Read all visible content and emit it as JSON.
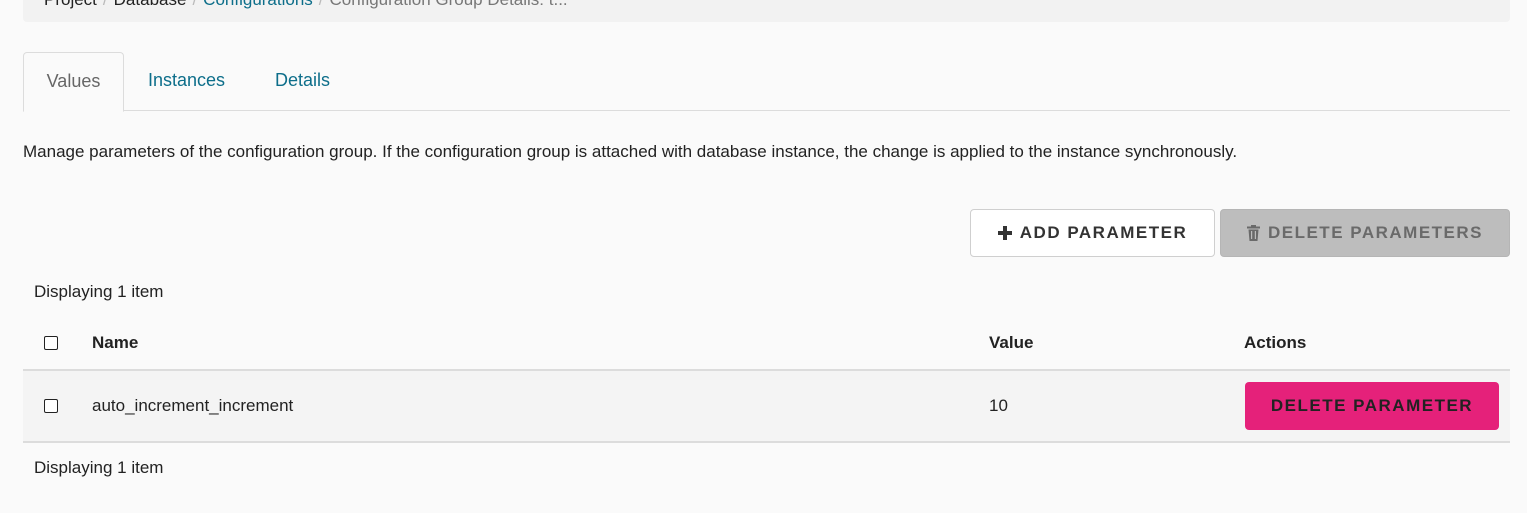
{
  "breadcrumb": {
    "items": [
      "Project",
      "Database",
      "Configurations",
      "Configuration Group Details: t..."
    ],
    "separator": "/"
  },
  "tabs": [
    {
      "label": "Values",
      "active": true
    },
    {
      "label": "Instances",
      "active": false
    },
    {
      "label": "Details",
      "active": false
    }
  ],
  "description": "Manage parameters of the configuration group. If the configuration group is attached with database instance, the change is applied to the instance synchronously.",
  "toolbar": {
    "add_label": "ADD PARAMETER",
    "add_icon": "plus-icon",
    "delete_label": "DELETE PARAMETERS",
    "delete_icon": "trash-icon",
    "delete_disabled": true
  },
  "table": {
    "count_top": "Displaying 1 item",
    "count_bottom": "Displaying 1 item",
    "columns": [
      "Name",
      "Value",
      "Actions"
    ],
    "rows": [
      {
        "name": "auto_increment_increment",
        "value": "10",
        "action_label": "DELETE PARAMETER"
      }
    ]
  },
  "colors": {
    "link": "#0d6e8a",
    "danger": "#e5217a",
    "disabled": "#bdbdbd"
  }
}
